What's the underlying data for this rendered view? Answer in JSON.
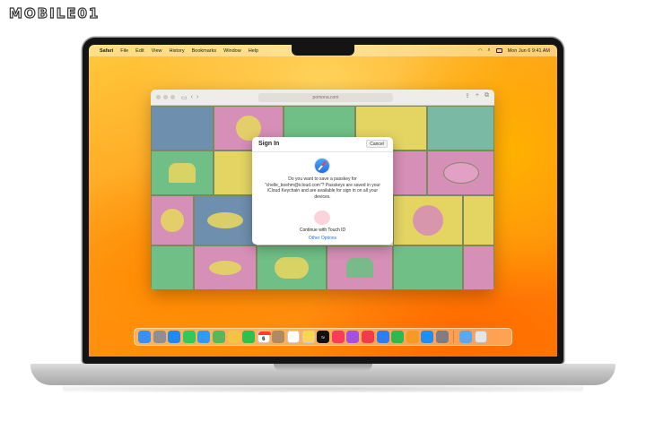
{
  "watermark": {
    "text": "MOBILE01"
  },
  "menubar": {
    "app_name": "Safari",
    "items": [
      "File",
      "Edit",
      "View",
      "History",
      "Bookmarks",
      "Window",
      "Help"
    ],
    "status_datetime": "Mon Jun 6  9:41 AM"
  },
  "safari": {
    "address": "pomona.com"
  },
  "sign_in_sheet": {
    "title": "Sign In",
    "cancel_label": "Cancel",
    "message": "Do you want to save a passkey for \"chelle_boehm@icloud.com\"? Passkeys are saved in your iCloud Keychain and are available for sign in on all your devices.",
    "touch_id_label": "Continue with Touch ID",
    "other_options_label": "Other Options"
  },
  "dock": {
    "calendar_day": "6",
    "tv_label": "tv",
    "apps": [
      {
        "name": "finder-app",
        "color": "#3a8ff2"
      },
      {
        "name": "launchpad-app",
        "color": "#8e8e93"
      },
      {
        "name": "safari-app",
        "color": "#1f88f2"
      },
      {
        "name": "messages-app",
        "color": "#34c759"
      },
      {
        "name": "mail-app",
        "color": "#2f9bf5"
      },
      {
        "name": "maps-app",
        "color": "#58b65b"
      },
      {
        "name": "photos-app",
        "color": "#f6c244"
      },
      {
        "name": "facetime-app",
        "color": "#2fbf4e"
      },
      {
        "name": "calendar-app",
        "color": "#ffffff"
      },
      {
        "name": "contacts-app",
        "color": "#b08965"
      },
      {
        "name": "reminders-app",
        "color": "#ffffff"
      },
      {
        "name": "notes-app",
        "color": "#f8d64f"
      },
      {
        "name": "tv-app",
        "color": "#111111"
      },
      {
        "name": "music-app",
        "color": "#fa3c5a"
      },
      {
        "name": "podcasts-app",
        "color": "#a550e0"
      },
      {
        "name": "news-app",
        "color": "#f43b4b"
      },
      {
        "name": "keynote-app",
        "color": "#2c7ef2"
      },
      {
        "name": "numbers-app",
        "color": "#2fb84e"
      },
      {
        "name": "pages-app",
        "color": "#f59a23"
      },
      {
        "name": "app-store-app",
        "color": "#1c8ef5"
      },
      {
        "name": "system-settings-app",
        "color": "#7d7d82"
      }
    ],
    "stack_apps": [
      {
        "name": "downloads-folder",
        "color": "#5aa8f0"
      },
      {
        "name": "trash",
        "color": "#e5e5e5"
      }
    ]
  }
}
